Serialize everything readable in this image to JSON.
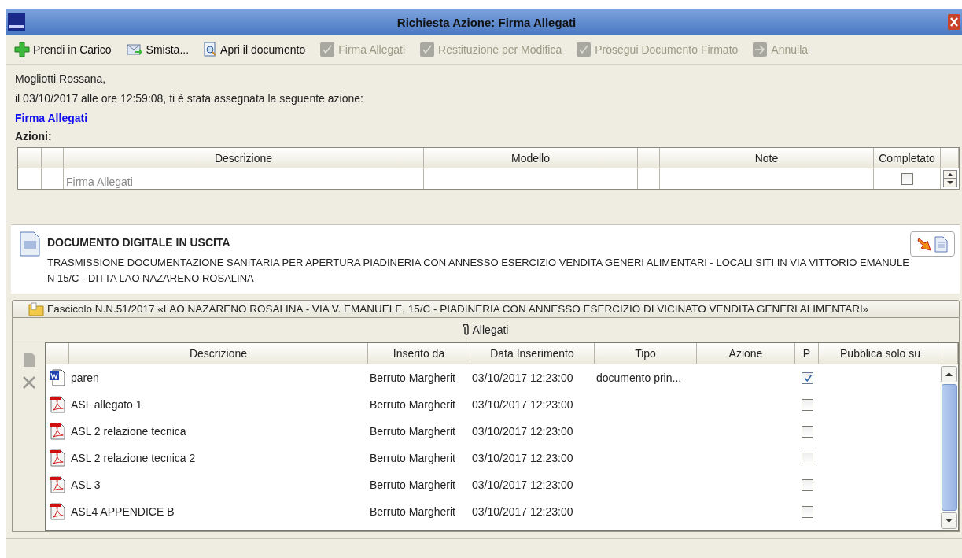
{
  "window": {
    "title": "Richiesta Azione: Firma Allegati"
  },
  "toolbar": [
    {
      "label": "Prendi in Carico",
      "kind": "add",
      "disabled": false
    },
    {
      "label": "Smista...",
      "kind": "forward",
      "disabled": false
    },
    {
      "label": "Apri il documento",
      "kind": "open",
      "disabled": false
    },
    {
      "label": "Firma Allegati",
      "kind": "check",
      "disabled": true
    },
    {
      "label": "Restituzione per Modifica",
      "kind": "check",
      "disabled": true
    },
    {
      "label": "Prosegui Documento Firmato",
      "kind": "check",
      "disabled": true
    },
    {
      "label": "Annulla",
      "kind": "arrow",
      "disabled": true
    }
  ],
  "greeting": "Mogliotti Rossana,",
  "assignment": "il 03/10/2017 alle ore 12:59:08, ti è stata assegnata la seguente azione:",
  "action_name": "Firma Allegati",
  "actions_label": "Azioni:",
  "actions_table": {
    "columns": {
      "description": "Descrizione",
      "model": "Modello",
      "note": "Note",
      "completed": "Completato"
    },
    "rows": [
      {
        "description": "Firma Allegati",
        "completed": false
      }
    ]
  },
  "document": {
    "title": "DOCUMENTO DIGITALE IN USCITA",
    "description": "TRASMISSIONE DOCUMENTAZIONE SANITARIA PER APERTURA PIADINERIA CON ANNESSO ESERCIZIO VENDITA GENERI ALIMENTARI  - LOCALI SITI  IN VIA VITTORIO EMANULE N 15/C - DITTA LAO NAZARENO ROSALINA"
  },
  "fascicolo": "Fascicolo N.N.51/2017 «LAO NAZARENO ROSALINA - VIA V. EMANUELE, 15/C - PIADINERIA CON ANNESSO ESERCIZIO DI VICINATO VENDITA GENERI ALIMENTARI»",
  "attachments_label": "Allegati",
  "attachments": {
    "columns": {
      "description": "Descrizione",
      "inserted_by": "Inserito da",
      "date": "Data Inserimento",
      "type": "Tipo",
      "action": "Azione",
      "p": "P",
      "publish": "Pubblica solo su"
    },
    "rows": [
      {
        "kind": "word",
        "description": "paren",
        "inserted_by": "Berruto Margherit",
        "date": "03/10/2017 12:23:00",
        "type": "documento prin...",
        "p": true
      },
      {
        "kind": "pdf",
        "description": "ASL allegato 1",
        "inserted_by": "Berruto Margherit",
        "date": "03/10/2017 12:23:00",
        "p": false
      },
      {
        "kind": "pdf",
        "description": "ASL 2 relazione tecnica",
        "inserted_by": "Berruto Margherit",
        "date": "03/10/2017 12:23:00",
        "p": false
      },
      {
        "kind": "pdf",
        "description": "ASL 2 relazione tecnica 2",
        "inserted_by": "Berruto Margherit",
        "date": "03/10/2017 12:23:00",
        "p": false
      },
      {
        "kind": "pdf",
        "description": "ASL 3",
        "inserted_by": "Berruto Margherit",
        "date": "03/10/2017 12:23:00",
        "p": false
      },
      {
        "kind": "pdf",
        "description": "ASL4 APPENDICE B",
        "inserted_by": "Berruto Margherit",
        "date": "03/10/2017 12:23:00",
        "p": false
      }
    ]
  }
}
